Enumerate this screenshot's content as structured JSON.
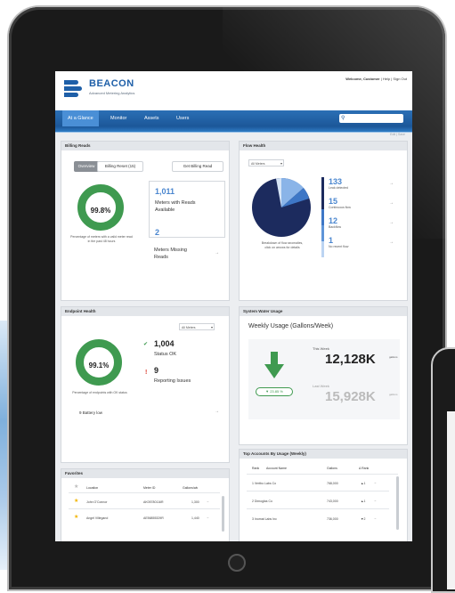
{
  "header": {
    "brand": "BEACON",
    "tagline": "Advanced Metering Analytics",
    "welcome": "Welcome, Customer",
    "help": "Help",
    "signout": "Sign Out"
  },
  "nav": {
    "tabs": [
      "At a Glance",
      "Monitor",
      "Assets",
      "Users"
    ],
    "active": 0
  },
  "breadcrumb": "Edit | Save",
  "billing": {
    "title": "Billing Reads",
    "tab_overview": "Overview",
    "tab_reset": "Billing Reset (15)",
    "get_button": "Get Billing Read",
    "percent": "99.8%",
    "caption": "Percentage of meters with a valid meter read in the past 48 hours",
    "meters_count": "1,011",
    "meters_label": "Meters with Reads Available",
    "missing_count": "2",
    "missing_label": "Meters Missing Reads"
  },
  "flow": {
    "title": "Flow Health",
    "select": "All Meters",
    "caption": "Breakdown of flow anomalies, click on arrows for details",
    "items": [
      {
        "count": "133",
        "label": "Leak detected"
      },
      {
        "count": "15",
        "label": "Continuous flow"
      },
      {
        "count": "12",
        "label": "Backflow"
      },
      {
        "count": "1",
        "label": "No recent flow"
      }
    ]
  },
  "endpoint": {
    "title": "Endpoint Health",
    "select": "All Meters",
    "percent": "99.1%",
    "caption": "Percentage of endpoints with OK status",
    "ok_count": "1,004",
    "ok_label": "Status OK",
    "issues_count": "9",
    "issues_label": "Reporting Issues",
    "battery": "9 Battery low"
  },
  "water": {
    "title": "System Water Usage",
    "heading": "Weekly Usage (Gallons/Week)",
    "this_week_label": "This Week",
    "this_week_value": "12,128K",
    "units": "gallons",
    "last_week_label": "Last Week",
    "last_week_value": "15,928K",
    "change": "23.85 %"
  },
  "favorites": {
    "title": "Favorites",
    "cols": [
      "Location",
      "Meter ID",
      "Gallons/wk"
    ],
    "rows": [
      {
        "location": "John O'Connor",
        "meter": "AK05780116R",
        "gallons": "1,300"
      },
      {
        "location": "Angel Villegand",
        "meter": "AE56855329R",
        "gallons": "1,440"
      }
    ]
  },
  "top_accounts": {
    "title": "Top Accounts By Usage (Weekly)",
    "cols": [
      "Rank",
      "Account Name",
      "Gallons",
      "Δ Rank"
    ],
    "rows": [
      {
        "name": "1 Vertbo Labs Co",
        "gallons": "768,000",
        "delta": "▲1"
      },
      {
        "name": "2 Dimoglas Co",
        "gallons": "743,000",
        "delta": "▲1"
      },
      {
        "name": "3 Inomat Labs Inc",
        "gallons": "736,000",
        "delta": "▼2"
      }
    ]
  },
  "colors": {
    "accent": "#1e5fa8",
    "green": "#3f9a50",
    "blue_value": "#4a86cf",
    "donut_dark": "#1c2b5e"
  }
}
